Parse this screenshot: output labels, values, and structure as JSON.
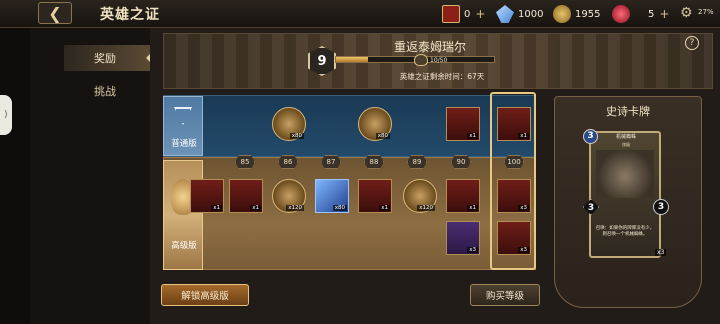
{
  "header": {
    "back_icon": "back-arrow-icon",
    "title": "英雄之证"
  },
  "resources": [
    {
      "icon": "ticket-icon",
      "value": "0"
    },
    {
      "icon": "crystal-icon",
      "value": "1000"
    },
    {
      "icon": "gold-coin-icon",
      "value": "1955"
    },
    {
      "icon": "ruby-icon",
      "value": "5"
    }
  ],
  "status": {
    "battery": "27%"
  },
  "nav": {
    "items": [
      {
        "label": "奖励",
        "active": true
      },
      {
        "label": "挑战",
        "active": false
      }
    ]
  },
  "banner": {
    "level": "9",
    "event_name": "重返泰姆瑞尔",
    "progress_text": "10/50",
    "progress_fraction": 0.2,
    "time_left": "英雄之证剩余时间：67天",
    "help": "?"
  },
  "track": {
    "normal_label": "普通版",
    "premium_label": "高级版",
    "levels": [
      "85",
      "86",
      "87",
      "88",
      "89",
      "90",
      "100"
    ],
    "normal_rewards": [
      {
        "type": "coin",
        "qty": "x80"
      },
      {
        "type": "coin",
        "qty": "x80"
      },
      {
        "type": "card",
        "qty": "x1"
      },
      {
        "type": "card",
        "qty": "x1"
      }
    ],
    "premium_rewards": [
      {
        "type": "card",
        "qty": "x1"
      },
      {
        "type": "card",
        "qty": "x1"
      },
      {
        "type": "coin",
        "qty": "x120"
      },
      {
        "type": "gem",
        "qty": "x80"
      },
      {
        "type": "card",
        "qty": "x1"
      },
      {
        "type": "coin",
        "qty": "x120"
      },
      {
        "type": "card",
        "qty": "x1"
      },
      {
        "type": "card",
        "qty": "x3"
      },
      {
        "type": "pcard",
        "qty": "x3"
      },
      {
        "type": "card",
        "qty": "x3"
      }
    ]
  },
  "epic_card": {
    "title": "史诗卡牌",
    "name": "机械蜘蛛",
    "type": "傀儡",
    "cost": "3",
    "attack": "3",
    "health": "3",
    "text": "召唤：如果你的牌库没有少，则召唤一个机械蜘蛛。",
    "qty": "x3"
  },
  "buttons": {
    "unlock": "解锁高级版",
    "buy_level": "购买等级"
  }
}
